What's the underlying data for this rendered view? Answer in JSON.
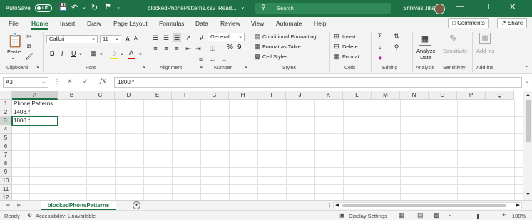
{
  "titlebar": {
    "autosave_label": "AutoSave",
    "autosave_state": "Off",
    "filename": "blockedPhonePatterns.csv",
    "mode": "Read...",
    "search_placeholder": "Search",
    "user_name": "Srinivas Jilla"
  },
  "menu": {
    "tabs": [
      "File",
      "Home",
      "Insert",
      "Draw",
      "Page Layout",
      "Formulas",
      "Data",
      "Review",
      "View",
      "Automate",
      "Help"
    ],
    "active_tab": "Home",
    "comments_label": "Comments",
    "share_label": "Share"
  },
  "ribbon": {
    "clipboard": {
      "paste": "Paste",
      "group": "Clipboard"
    },
    "font": {
      "name": "Calibri",
      "size": "11",
      "bold": "B",
      "italic": "I",
      "underline": "U",
      "grow": "A",
      "shrink": "A",
      "color": "A",
      "group": "Font"
    },
    "alignment": {
      "group": "Alignment"
    },
    "number": {
      "format": "General",
      "percent": "%",
      "comma": "9",
      "group": "Number"
    },
    "styles": {
      "conditional": "Conditional Formatting",
      "format_table": "Format as Table",
      "cell_styles": "Cell Styles",
      "group": "Styles"
    },
    "cells": {
      "insert": "Insert",
      "delete": "Delete",
      "format": "Format",
      "group": "Cells"
    },
    "editing": {
      "group": "Editing"
    },
    "analysis": {
      "analyze": "Analyze Data",
      "group": "Analysis"
    },
    "sensitivity": {
      "label": "Sensitivity",
      "group": "Sensitivity"
    },
    "addins": {
      "label": "Add-ins",
      "group": "Add-ins"
    }
  },
  "formula_bar": {
    "name_box": "A3",
    "fx": "fx",
    "value": "1800.*"
  },
  "grid": {
    "columns": [
      "A",
      "B",
      "C",
      "D",
      "E",
      "F",
      "G",
      "H",
      "I",
      "J",
      "K",
      "L",
      "M",
      "N",
      "O",
      "P",
      "Q"
    ],
    "rows": [
      "1",
      "2",
      "3",
      "4",
      "5",
      "6",
      "7",
      "8",
      "9",
      "10",
      "11",
      "12"
    ],
    "selected_column": "A",
    "selected_row": "3",
    "cells": {
      "A1": "Phone Patterns",
      "A2": "1408.*",
      "A3": "1800.*"
    }
  },
  "sheets": {
    "active": "blockedPhonePatterns",
    "add_label": "+"
  },
  "status": {
    "ready": "Ready",
    "accessibility": "Accessibility: Unavailable",
    "display_settings": "Display Settings",
    "zoom_minus": "-",
    "zoom_plus": "+",
    "zoom": "100%",
    "zoom_level": 1.0
  },
  "colors": {
    "accent": "#1e7145",
    "titlebar": "#1e7145"
  }
}
